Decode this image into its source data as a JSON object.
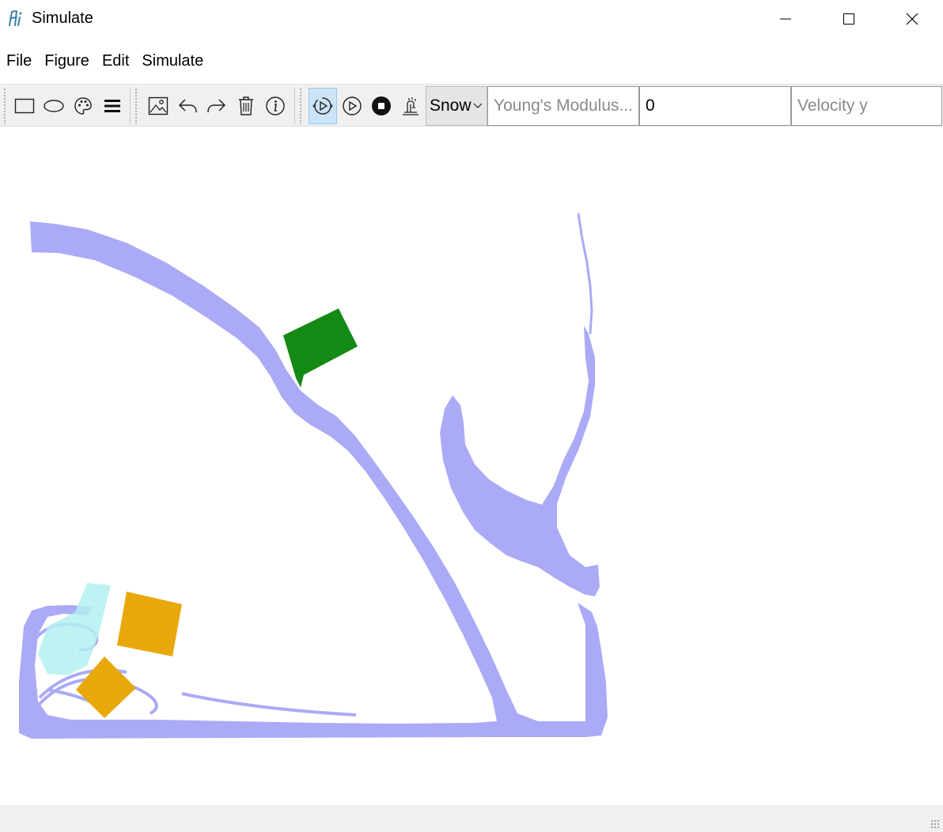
{
  "window": {
    "title": "Simulate",
    "icon": "app-logo-icon"
  },
  "menu": {
    "items": [
      "File",
      "Figure",
      "Edit",
      "Simulate"
    ]
  },
  "toolbar": {
    "material_select": "Snow",
    "param1_placeholder": "Young's Modulus...",
    "param2_value": "0",
    "param3_placeholder": "Velocity y",
    "icons": [
      "rectangle-icon",
      "ellipse-icon",
      "palette-icon",
      "menu-icon",
      "image-icon",
      "undo-icon",
      "redo-icon",
      "trash-icon",
      "info-icon",
      "step-play-icon",
      "play-icon",
      "stop-icon",
      "emitter-icon"
    ]
  },
  "colors": {
    "fluid": "#aaaaf6",
    "green_block": "#148a14",
    "orange_block": "#e8a80c",
    "cyan_particles": "#b4f0f0",
    "toolbar_bg": "#f0f0f0",
    "active_button": "#cce4f7"
  }
}
